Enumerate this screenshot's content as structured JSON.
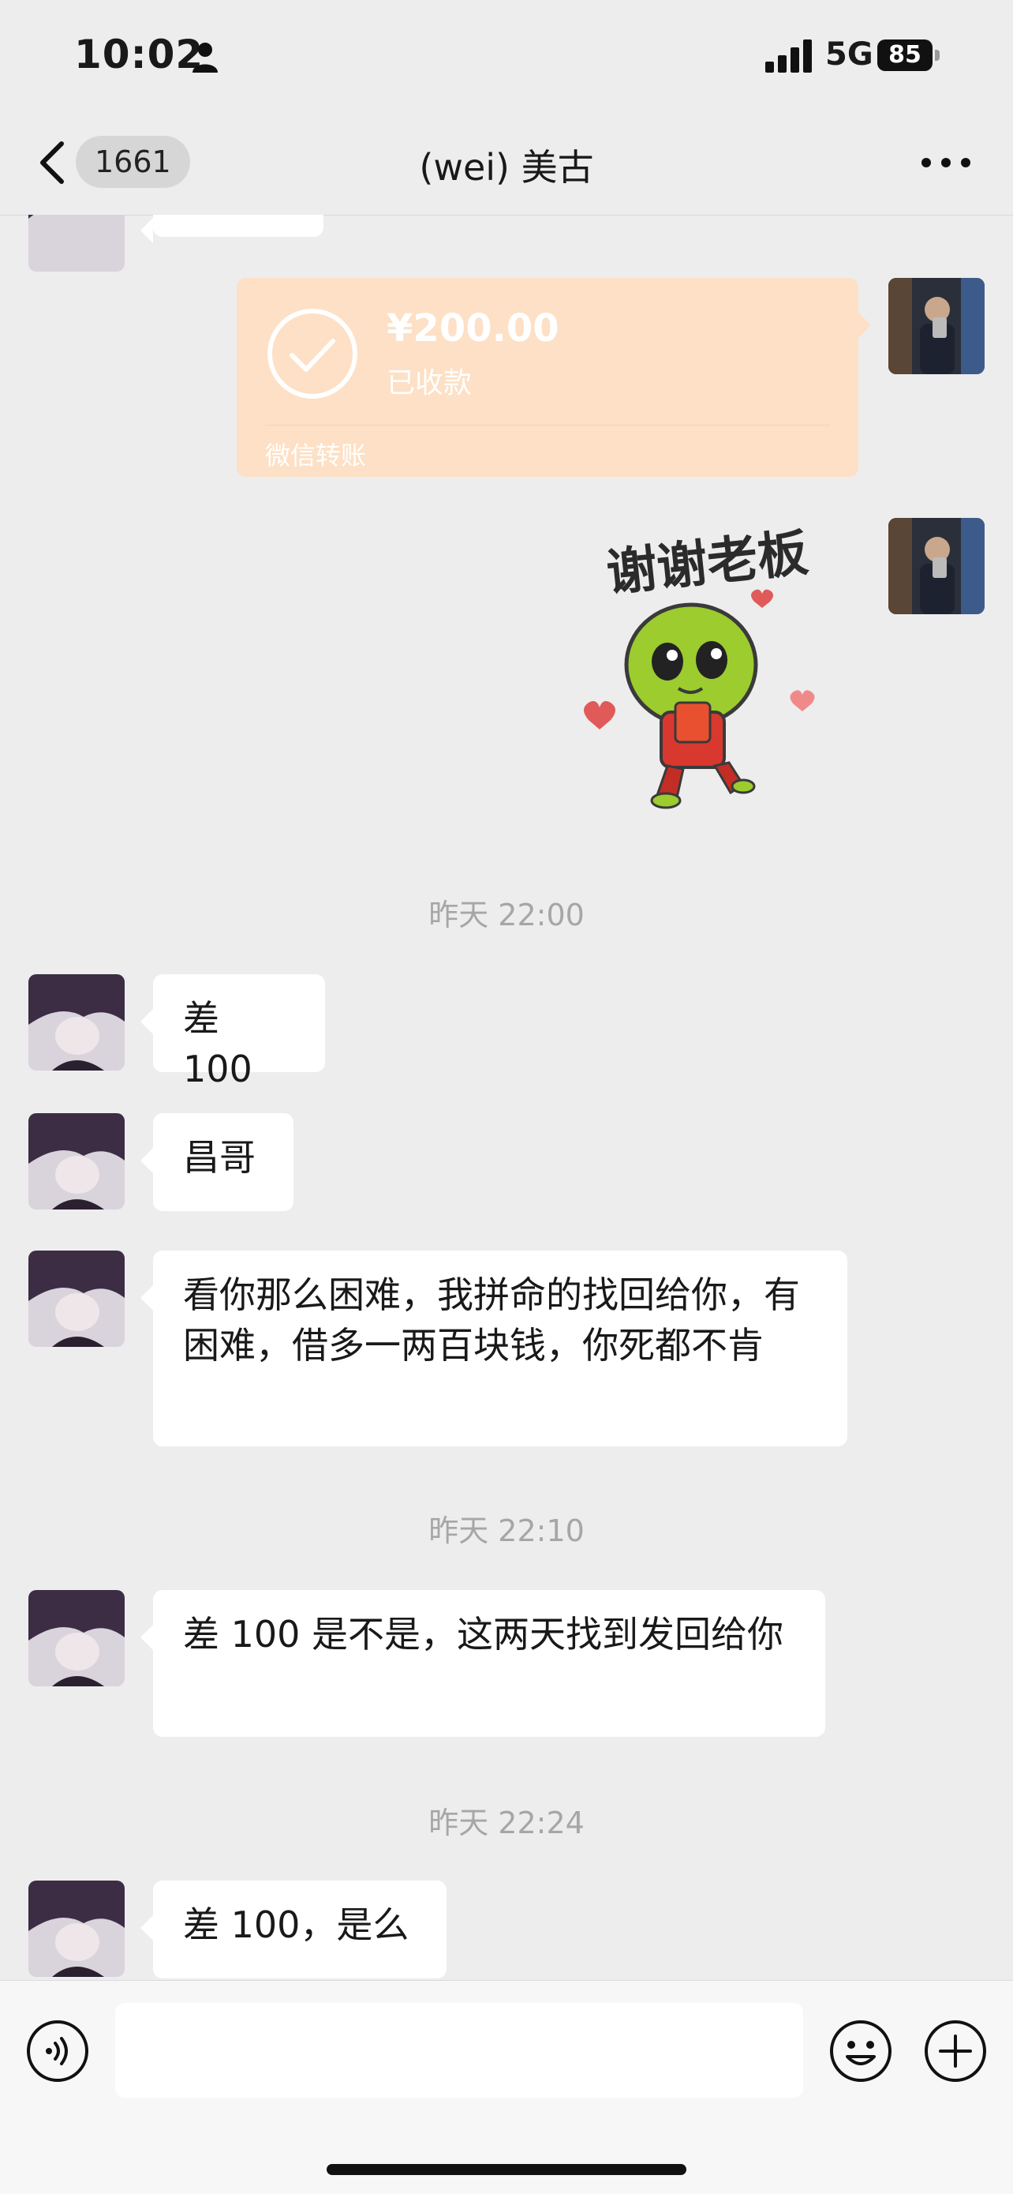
{
  "status_bar": {
    "time": "10:02",
    "network": "5G",
    "battery": "85"
  },
  "nav": {
    "back_count": "1661",
    "title": "(wei)  美古"
  },
  "transfer": {
    "amount": "¥200.00",
    "status": "已收款",
    "footer": "微信转账"
  },
  "sticker": {
    "text": "谢谢老板"
  },
  "messages": {
    "ts1": "昨天 22:00",
    "m1": "差 100",
    "m2": "昌哥",
    "m3": "看你那么困难，我拼命的找回给你，有困难，借多一两百块钱，你死都不肯",
    "ts2": "昨天 22:10",
    "m4": "差 100 是不是，这两天找到发回给你",
    "ts3": "昨天 22:24",
    "m5": "差 100，是么"
  },
  "input": {
    "placeholder": ""
  },
  "colors": {
    "background": "#ededed",
    "bubble": "#ffffff",
    "transfer": "#fde0c5",
    "timestamp": "#a6a6a6"
  }
}
